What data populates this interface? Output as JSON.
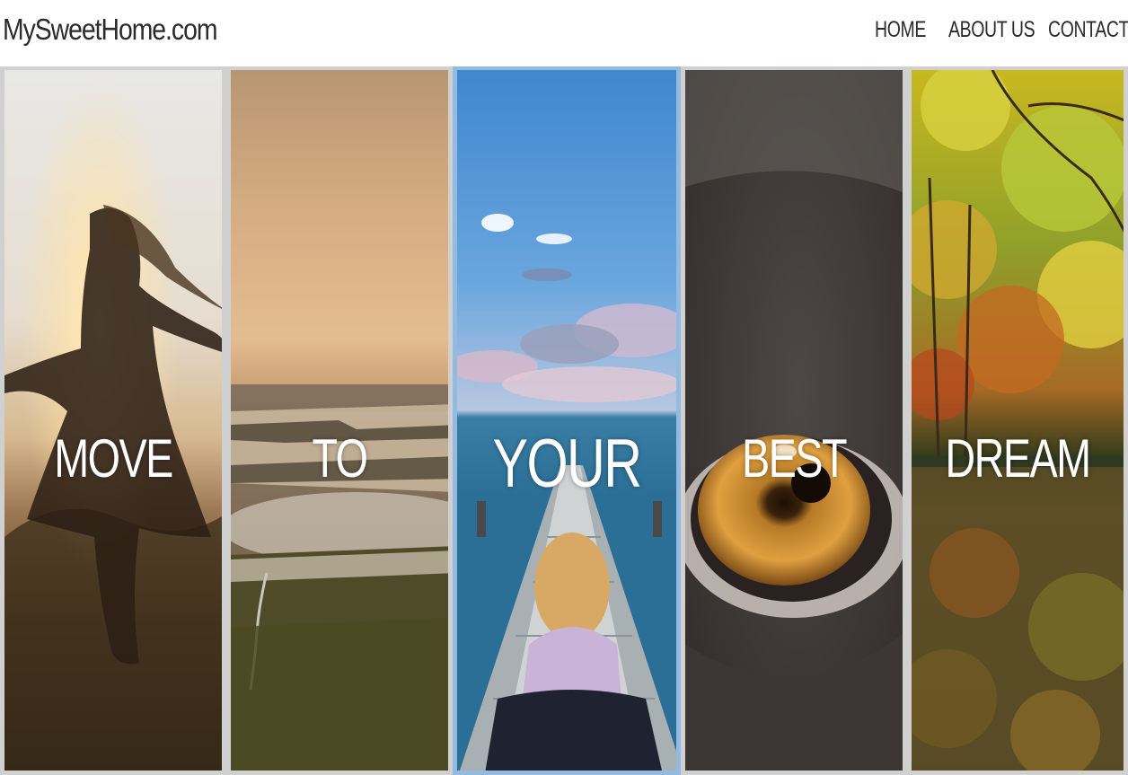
{
  "header": {
    "logo": "MySweetHome.com",
    "nav": [
      {
        "label": "HOME"
      },
      {
        "label": "ABOUT US"
      },
      {
        "label": "CONTACT"
      }
    ]
  },
  "panels": [
    {
      "word": "MOVE",
      "image": "woman-dancing-at-sunset"
    },
    {
      "word": "TO",
      "image": "aerial-wetland-at-dawn"
    },
    {
      "word": "YOUR",
      "image": "woman-sitting-on-pier"
    },
    {
      "word": "BEST",
      "image": "dog-eye-closeup"
    },
    {
      "word": "DREAM",
      "image": "autumn-forest-lake"
    }
  ]
}
